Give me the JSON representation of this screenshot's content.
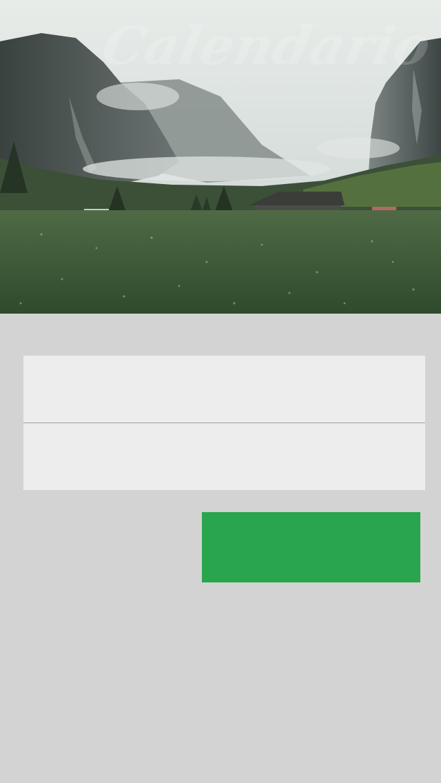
{
  "hero": {
    "title": "Calendario",
    "image_name": "mountain-valley-photo"
  },
  "form": {
    "field_1": {
      "value": "",
      "placeholder": ""
    },
    "field_2": {
      "value": "",
      "placeholder": ""
    }
  },
  "action_button": {
    "label": "",
    "color": "#28a54d"
  },
  "colors": {
    "background": "#d3d3d3",
    "card": "#ededed",
    "divider": "#9e9e9e",
    "accent": "#28a54d"
  }
}
